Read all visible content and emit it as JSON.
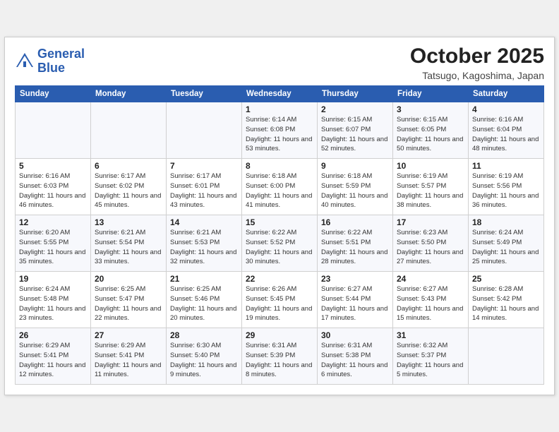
{
  "header": {
    "logo_line1": "General",
    "logo_line2": "Blue",
    "month": "October 2025",
    "location": "Tatsugo, Kagoshima, Japan"
  },
  "weekdays": [
    "Sunday",
    "Monday",
    "Tuesday",
    "Wednesday",
    "Thursday",
    "Friday",
    "Saturday"
  ],
  "weeks": [
    [
      {
        "day": "",
        "sunrise": "",
        "sunset": "",
        "daylight": ""
      },
      {
        "day": "",
        "sunrise": "",
        "sunset": "",
        "daylight": ""
      },
      {
        "day": "",
        "sunrise": "",
        "sunset": "",
        "daylight": ""
      },
      {
        "day": "1",
        "sunrise": "Sunrise: 6:14 AM",
        "sunset": "Sunset: 6:08 PM",
        "daylight": "Daylight: 11 hours and 53 minutes."
      },
      {
        "day": "2",
        "sunrise": "Sunrise: 6:15 AM",
        "sunset": "Sunset: 6:07 PM",
        "daylight": "Daylight: 11 hours and 52 minutes."
      },
      {
        "day": "3",
        "sunrise": "Sunrise: 6:15 AM",
        "sunset": "Sunset: 6:05 PM",
        "daylight": "Daylight: 11 hours and 50 minutes."
      },
      {
        "day": "4",
        "sunrise": "Sunrise: 6:16 AM",
        "sunset": "Sunset: 6:04 PM",
        "daylight": "Daylight: 11 hours and 48 minutes."
      }
    ],
    [
      {
        "day": "5",
        "sunrise": "Sunrise: 6:16 AM",
        "sunset": "Sunset: 6:03 PM",
        "daylight": "Daylight: 11 hours and 46 minutes."
      },
      {
        "day": "6",
        "sunrise": "Sunrise: 6:17 AM",
        "sunset": "Sunset: 6:02 PM",
        "daylight": "Daylight: 11 hours and 45 minutes."
      },
      {
        "day": "7",
        "sunrise": "Sunrise: 6:17 AM",
        "sunset": "Sunset: 6:01 PM",
        "daylight": "Daylight: 11 hours and 43 minutes."
      },
      {
        "day": "8",
        "sunrise": "Sunrise: 6:18 AM",
        "sunset": "Sunset: 6:00 PM",
        "daylight": "Daylight: 11 hours and 41 minutes."
      },
      {
        "day": "9",
        "sunrise": "Sunrise: 6:18 AM",
        "sunset": "Sunset: 5:59 PM",
        "daylight": "Daylight: 11 hours and 40 minutes."
      },
      {
        "day": "10",
        "sunrise": "Sunrise: 6:19 AM",
        "sunset": "Sunset: 5:57 PM",
        "daylight": "Daylight: 11 hours and 38 minutes."
      },
      {
        "day": "11",
        "sunrise": "Sunrise: 6:19 AM",
        "sunset": "Sunset: 5:56 PM",
        "daylight": "Daylight: 11 hours and 36 minutes."
      }
    ],
    [
      {
        "day": "12",
        "sunrise": "Sunrise: 6:20 AM",
        "sunset": "Sunset: 5:55 PM",
        "daylight": "Daylight: 11 hours and 35 minutes."
      },
      {
        "day": "13",
        "sunrise": "Sunrise: 6:21 AM",
        "sunset": "Sunset: 5:54 PM",
        "daylight": "Daylight: 11 hours and 33 minutes."
      },
      {
        "day": "14",
        "sunrise": "Sunrise: 6:21 AM",
        "sunset": "Sunset: 5:53 PM",
        "daylight": "Daylight: 11 hours and 32 minutes."
      },
      {
        "day": "15",
        "sunrise": "Sunrise: 6:22 AM",
        "sunset": "Sunset: 5:52 PM",
        "daylight": "Daylight: 11 hours and 30 minutes."
      },
      {
        "day": "16",
        "sunrise": "Sunrise: 6:22 AM",
        "sunset": "Sunset: 5:51 PM",
        "daylight": "Daylight: 11 hours and 28 minutes."
      },
      {
        "day": "17",
        "sunrise": "Sunrise: 6:23 AM",
        "sunset": "Sunset: 5:50 PM",
        "daylight": "Daylight: 11 hours and 27 minutes."
      },
      {
        "day": "18",
        "sunrise": "Sunrise: 6:24 AM",
        "sunset": "Sunset: 5:49 PM",
        "daylight": "Daylight: 11 hours and 25 minutes."
      }
    ],
    [
      {
        "day": "19",
        "sunrise": "Sunrise: 6:24 AM",
        "sunset": "Sunset: 5:48 PM",
        "daylight": "Daylight: 11 hours and 23 minutes."
      },
      {
        "day": "20",
        "sunrise": "Sunrise: 6:25 AM",
        "sunset": "Sunset: 5:47 PM",
        "daylight": "Daylight: 11 hours and 22 minutes."
      },
      {
        "day": "21",
        "sunrise": "Sunrise: 6:25 AM",
        "sunset": "Sunset: 5:46 PM",
        "daylight": "Daylight: 11 hours and 20 minutes."
      },
      {
        "day": "22",
        "sunrise": "Sunrise: 6:26 AM",
        "sunset": "Sunset: 5:45 PM",
        "daylight": "Daylight: 11 hours and 19 minutes."
      },
      {
        "day": "23",
        "sunrise": "Sunrise: 6:27 AM",
        "sunset": "Sunset: 5:44 PM",
        "daylight": "Daylight: 11 hours and 17 minutes."
      },
      {
        "day": "24",
        "sunrise": "Sunrise: 6:27 AM",
        "sunset": "Sunset: 5:43 PM",
        "daylight": "Daylight: 11 hours and 15 minutes."
      },
      {
        "day": "25",
        "sunrise": "Sunrise: 6:28 AM",
        "sunset": "Sunset: 5:42 PM",
        "daylight": "Daylight: 11 hours and 14 minutes."
      }
    ],
    [
      {
        "day": "26",
        "sunrise": "Sunrise: 6:29 AM",
        "sunset": "Sunset: 5:41 PM",
        "daylight": "Daylight: 11 hours and 12 minutes."
      },
      {
        "day": "27",
        "sunrise": "Sunrise: 6:29 AM",
        "sunset": "Sunset: 5:41 PM",
        "daylight": "Daylight: 11 hours and 11 minutes."
      },
      {
        "day": "28",
        "sunrise": "Sunrise: 6:30 AM",
        "sunset": "Sunset: 5:40 PM",
        "daylight": "Daylight: 11 hours and 9 minutes."
      },
      {
        "day": "29",
        "sunrise": "Sunrise: 6:31 AM",
        "sunset": "Sunset: 5:39 PM",
        "daylight": "Daylight: 11 hours and 8 minutes."
      },
      {
        "day": "30",
        "sunrise": "Sunrise: 6:31 AM",
        "sunset": "Sunset: 5:38 PM",
        "daylight": "Daylight: 11 hours and 6 minutes."
      },
      {
        "day": "31",
        "sunrise": "Sunrise: 6:32 AM",
        "sunset": "Sunset: 5:37 PM",
        "daylight": "Daylight: 11 hours and 5 minutes."
      },
      {
        "day": "",
        "sunrise": "",
        "sunset": "",
        "daylight": ""
      }
    ]
  ]
}
